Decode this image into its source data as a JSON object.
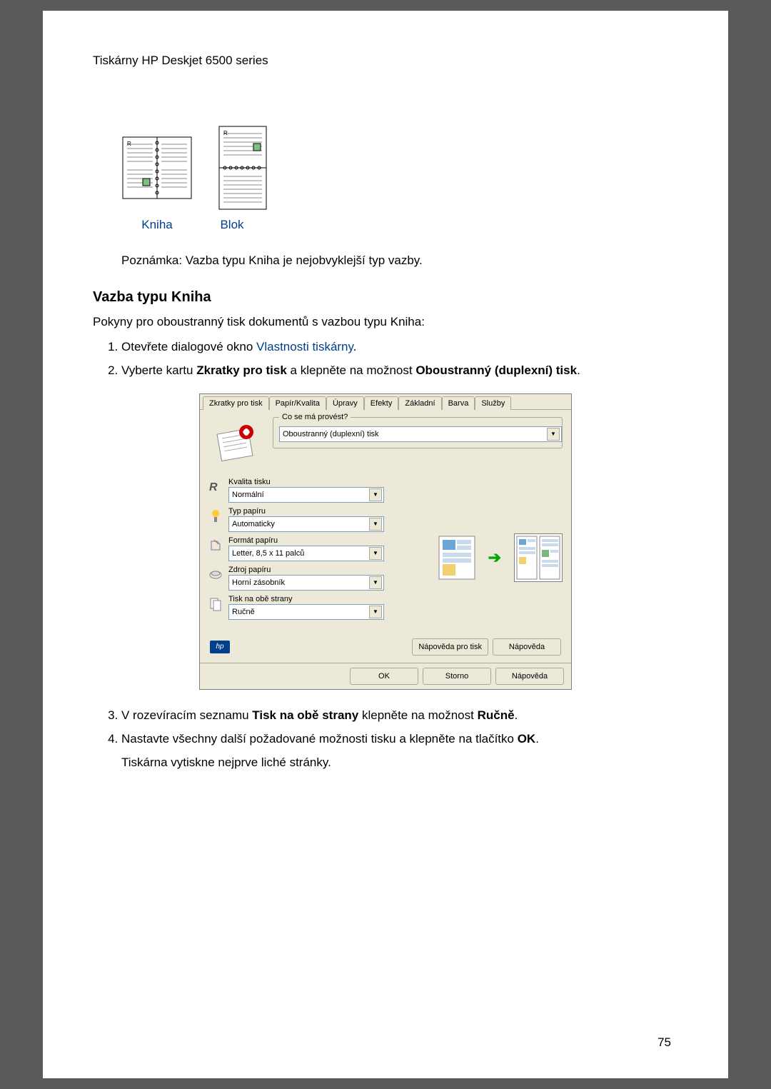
{
  "header": {
    "title": "Tiskárny HP Deskjet 6500 series"
  },
  "binding": {
    "book_label": "Kniha",
    "pad_label": "Blok"
  },
  "note": "Poznámka:  Vazba typu Kniha je nejobvyklejší typ vazby.",
  "section_heading": "Vazba typu Kniha",
  "intro": "Pokyny pro oboustranný tisk dokumentů s vazbou typu Kniha:",
  "step1_a": "Otevřete dialogové okno ",
  "step1_link": "Vlastnosti tiskárny",
  "step1_b": ".",
  "step2_a": "Vyberte kartu ",
  "step2_b1": "Zkratky pro tisk",
  "step2_c": " a klepněte na možnost ",
  "step2_b2": "Oboustranný (duplexní) tisk",
  "step2_d": ".",
  "dialog": {
    "tabs": [
      "Zkratky pro tisk",
      "Papír/Kvalita",
      "Úpravy",
      "Efekty",
      "Základní",
      "Barva",
      "Služby"
    ],
    "fieldset_label": "Co se má provést?",
    "task_value": "Oboustranný (duplexní) tisk",
    "quality_label": "Kvalita tisku",
    "quality_value": "Normální",
    "papertype_label": "Typ papíru",
    "papertype_value": "Automaticky",
    "format_label": "Formát papíru",
    "format_value": "Letter, 8,5 x 11 palců",
    "source_label": "Zdroj papíru",
    "source_value": "Horní zásobník",
    "duplex_label": "Tisk na obě strany",
    "duplex_value": "Ručně",
    "help_print": "Nápověda pro tisk",
    "help": "Nápověda",
    "ok": "OK",
    "cancel": "Storno",
    "help2": "Nápověda"
  },
  "step3_a": "V rozevíracím seznamu ",
  "step3_b1": "Tisk na obě strany",
  "step3_c": " klepněte na možnost ",
  "step3_b2": "Ručně",
  "step3_d": ".",
  "step4_a": "Nastavte všechny další požadované možnosti tisku a klepněte na tlačítko ",
  "step4_b": "OK",
  "step4_c": ".",
  "step4_tail": "Tiskárna vytiskne nejprve liché stránky.",
  "page_number": "75"
}
